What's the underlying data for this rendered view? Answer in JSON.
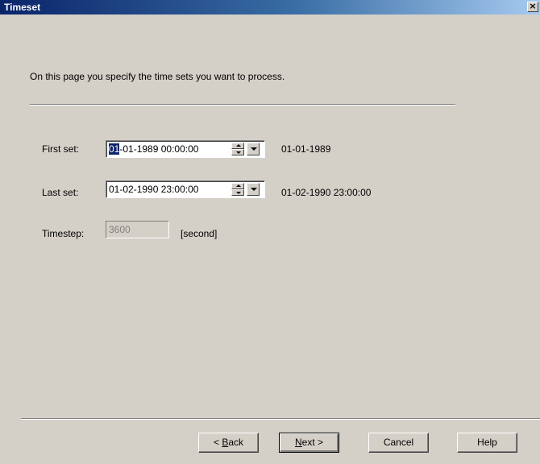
{
  "window": {
    "title": "Timeset",
    "close_glyph": "×"
  },
  "intro_text": "On this page you specify the time sets you want to process.",
  "first_set": {
    "label": "First set:",
    "value_selected": "01",
    "value_rest": "-01-1989 00:00:00",
    "display": "01-01-1989"
  },
  "last_set": {
    "label": "Last set:",
    "value": "01-02-1990 23:00:00",
    "display": "01-02-1990 23:00:00"
  },
  "timestep": {
    "label": "Timestep:",
    "value": "3600",
    "unit": "[second]"
  },
  "buttons": {
    "back_prefix": "< ",
    "back_mnemonic": "B",
    "back_rest": "ack",
    "next_mnemonic": "N",
    "next_rest": "ext >",
    "cancel": "Cancel",
    "help": "Help"
  },
  "icons": {
    "close": "close-icon",
    "spin_up": "spin-up-icon",
    "spin_down": "spin-down-icon",
    "dropdown": "chevron-down-icon"
  },
  "colors": {
    "dialog_bg": "#d4d0c8",
    "title_start": "#0a246a",
    "title_end": "#a6caf0",
    "selection": "#0a246a"
  }
}
